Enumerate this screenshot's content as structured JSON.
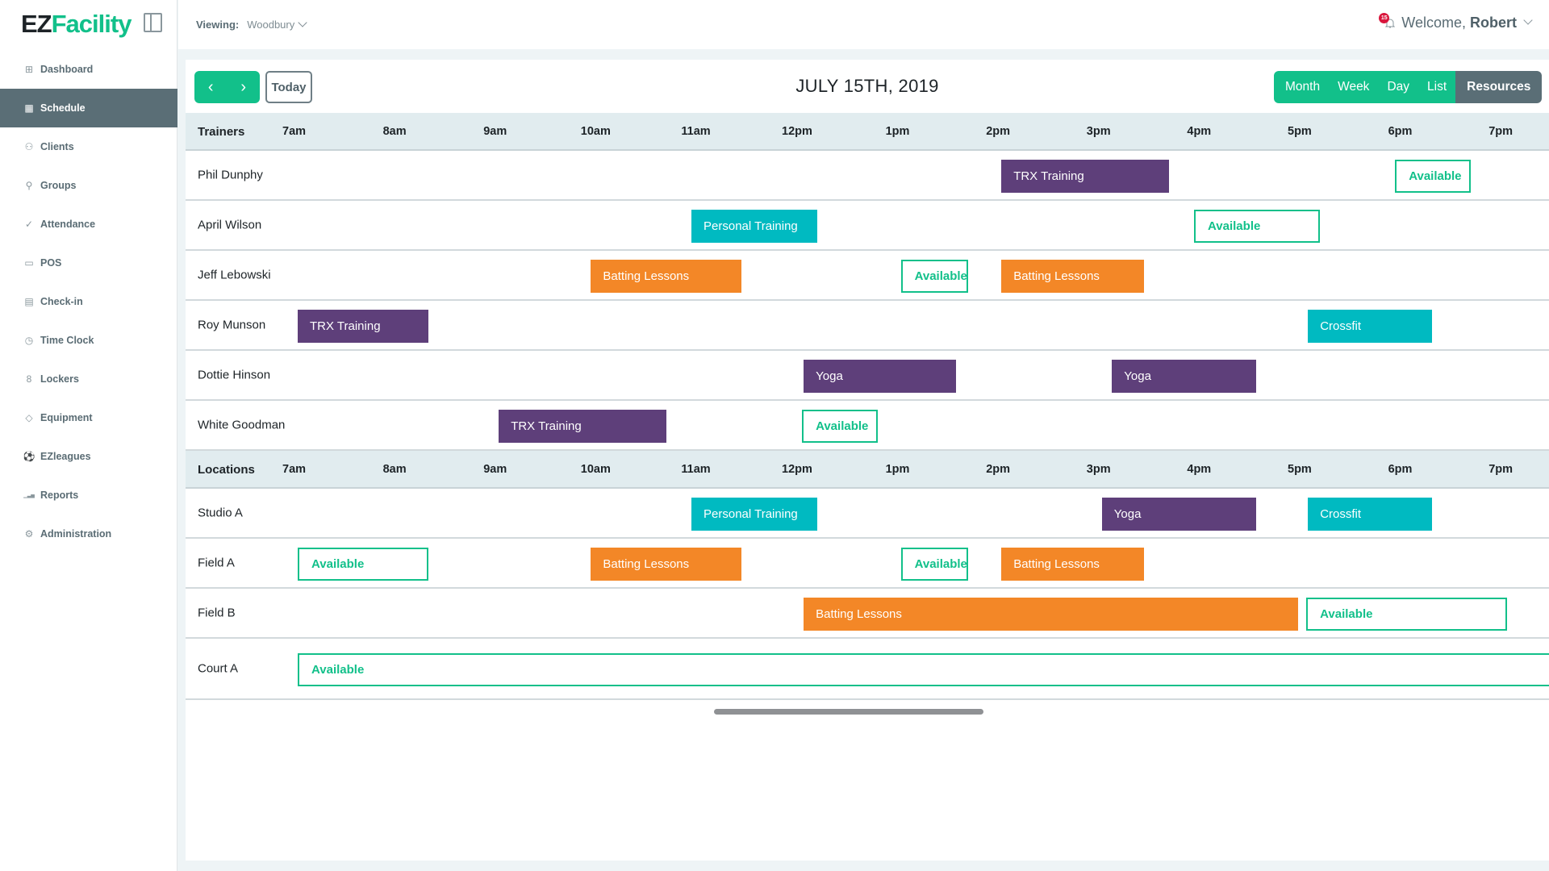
{
  "app": {
    "logo_part1": "EZ",
    "logo_part2": "Facility"
  },
  "sidebar": {
    "items": [
      {
        "label": "Dashboard",
        "icon": "dashboard-icon",
        "glyph": "⊞",
        "active": false
      },
      {
        "label": "Schedule",
        "icon": "calendar-icon",
        "glyph": "▦",
        "active": true
      },
      {
        "label": "Clients",
        "icon": "clients-icon",
        "glyph": "⚇",
        "active": false
      },
      {
        "label": "Groups",
        "icon": "groups-icon",
        "glyph": "⚲",
        "active": false
      },
      {
        "label": "Attendance",
        "icon": "check-icon",
        "glyph": "✓",
        "active": false
      },
      {
        "label": "POS",
        "icon": "pos-icon",
        "glyph": "▭",
        "active": false
      },
      {
        "label": "Check-in",
        "icon": "checkin-icon",
        "glyph": "▤",
        "active": false
      },
      {
        "label": "Time Clock",
        "icon": "clock-icon",
        "glyph": "◷",
        "active": false
      },
      {
        "label": "Lockers",
        "icon": "lock-icon",
        "glyph": "8",
        "active": false
      },
      {
        "label": "Equipment",
        "icon": "tag-icon",
        "glyph": "◇",
        "active": false
      },
      {
        "label": "EZleagues",
        "icon": "ball-icon",
        "glyph": "⚽",
        "active": false
      },
      {
        "label": "Reports",
        "icon": "bar-chart-icon",
        "glyph": "▁▃▅",
        "active": false
      },
      {
        "label": "Administration",
        "icon": "gear-icon",
        "glyph": "⚙",
        "active": false
      }
    ]
  },
  "topbar": {
    "viewing_label": "Viewing:",
    "viewing_value": "Woodbury",
    "notification_count": "15",
    "welcome_text": "Welcome,",
    "user_name": "Robert"
  },
  "toolbar": {
    "prev_label": "‹",
    "next_label": "›",
    "today_label": "Today",
    "date_title": "JULY 15TH, 2019",
    "views": [
      {
        "label": "Month",
        "active": false
      },
      {
        "label": "Week",
        "active": false
      },
      {
        "label": "Day",
        "active": false
      },
      {
        "label": "List",
        "active": false
      },
      {
        "label": "Resources",
        "active": true
      }
    ]
  },
  "colors": {
    "accent": "#12c08a",
    "purple": "#5e3f7a",
    "orange": "#f38727",
    "teal": "#00bac1",
    "sidebar_active": "#5a6e76"
  },
  "schedule": {
    "hours": [
      "7am",
      "8am",
      "9am",
      "10am",
      "11am",
      "12pm",
      "1pm",
      "2pm",
      "3pm",
      "4pm",
      "5pm",
      "6pm",
      "7pm"
    ],
    "sections": [
      {
        "title": "Trainers",
        "rows": [
          {
            "name": "Phil Dunphy",
            "events": [
              {
                "label": "TRX Training",
                "type": "purple",
                "start": "14:00",
                "end": "15:40"
              },
              {
                "label": "Available",
                "type": "avail",
                "start": "17:55",
                "end": "18:40"
              }
            ]
          },
          {
            "name": "April Wilson",
            "events": [
              {
                "label": "Personal Training",
                "type": "teal",
                "start": "10:55",
                "end": "12:10"
              },
              {
                "label": "Available",
                "type": "avail",
                "start": "15:55",
                "end": "17:10"
              }
            ]
          },
          {
            "name": "Jeff Lebowski",
            "events": [
              {
                "label": "Batting Lessons",
                "type": "orange",
                "start": "09:55",
                "end": "11:25"
              },
              {
                "label": "Available",
                "type": "avail",
                "start": "13:00",
                "end": "13:40"
              },
              {
                "label": "Batting Lessons",
                "type": "orange",
                "start": "14:00",
                "end": "15:25"
              }
            ]
          },
          {
            "name": "Roy Munson",
            "events": [
              {
                "label": "TRX Training",
                "type": "purple",
                "start": "07:00",
                "end": "08:18"
              },
              {
                "label": "Crossfit",
                "type": "teal",
                "start": "17:03",
                "end": "18:17"
              }
            ]
          },
          {
            "name": "Dottie Hinson",
            "events": [
              {
                "label": "Yoga",
                "type": "purple",
                "start": "12:02",
                "end": "13:33"
              },
              {
                "label": "Yoga",
                "type": "purple",
                "start": "15:06",
                "end": "16:32"
              }
            ]
          },
          {
            "name": "White Goodman",
            "events": [
              {
                "label": "TRX Training",
                "type": "purple",
                "start": "09:00",
                "end": "10:40"
              },
              {
                "label": "Available",
                "type": "avail",
                "start": "12:01",
                "end": "12:46"
              }
            ]
          }
        ]
      },
      {
        "title": "Locations",
        "rows": [
          {
            "name": "Studio A",
            "events": [
              {
                "label": "Personal Training",
                "type": "teal",
                "start": "10:55",
                "end": "12:10"
              },
              {
                "label": "Yoga",
                "type": "purple",
                "start": "15:00",
                "end": "16:32"
              },
              {
                "label": "Crossfit",
                "type": "teal",
                "start": "17:03",
                "end": "18:17"
              }
            ]
          },
          {
            "name": "Field A",
            "events": [
              {
                "label": "Available",
                "type": "avail",
                "start": "07:00",
                "end": "08:18"
              },
              {
                "label": "Batting Lessons",
                "type": "orange",
                "start": "09:55",
                "end": "11:25"
              },
              {
                "label": "Available",
                "type": "avail",
                "start": "13:00",
                "end": "13:40"
              },
              {
                "label": "Batting Lessons",
                "type": "orange",
                "start": "14:00",
                "end": "15:25"
              }
            ]
          },
          {
            "name": "Field B",
            "events": [
              {
                "label": "Batting Lessons",
                "type": "orange",
                "start": "12:02",
                "end": "16:57"
              },
              {
                "label": "Available",
                "type": "avail",
                "start": "17:02",
                "end": "19:02"
              }
            ]
          },
          {
            "name": "Court A",
            "events": [
              {
                "label": "Available",
                "type": "avail",
                "start": "07:00",
                "end": "20:00"
              }
            ]
          }
        ]
      }
    ]
  }
}
